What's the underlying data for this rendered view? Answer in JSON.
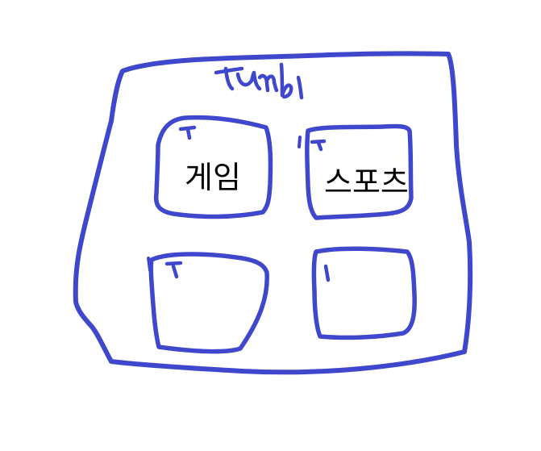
{
  "sketch": {
    "title": "tumbl",
    "stroke_color": "#3F48CC",
    "tiles": [
      {
        "label": "게임"
      },
      {
        "label": "스포츠"
      },
      {
        "label": ""
      },
      {
        "label": ""
      }
    ]
  }
}
